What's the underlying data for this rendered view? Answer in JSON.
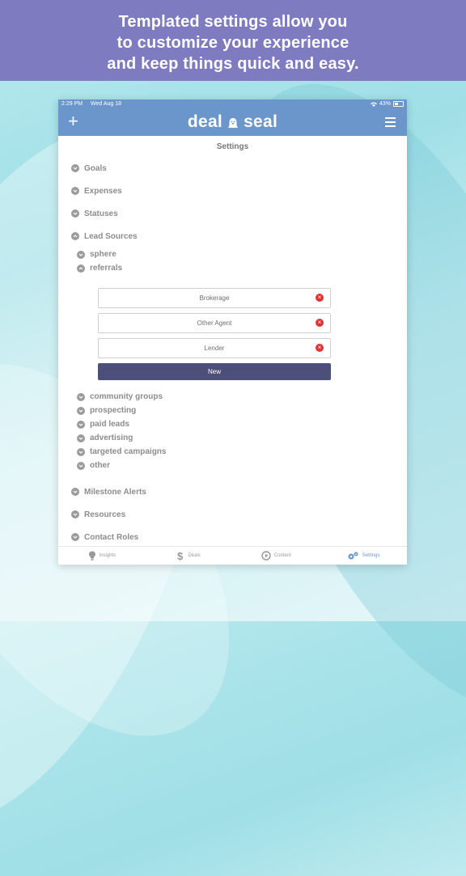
{
  "banner": {
    "line1": "Templated settings allow you",
    "line2": "to customize your experience",
    "line3": "and keep things quick and easy."
  },
  "statusbar": {
    "time": "2:29 PM",
    "date": "Wed Aug 18",
    "battery": "43%"
  },
  "app": {
    "logo_left": "deal",
    "logo_right": "seal",
    "plus": "+"
  },
  "colors": {
    "banner": "#7e7bc1",
    "nav": "#6b96cc",
    "new_button": "#4c4f79",
    "remove": "#e03333"
  },
  "settings": {
    "title": "Settings",
    "sections_top": [
      "Goals",
      "Expenses",
      "Statuses"
    ],
    "lead_sources": {
      "label": "Lead Sources",
      "sub_top": [
        "sphere",
        "referrals"
      ],
      "referrals_items": [
        "Brokerage",
        "Other Agent",
        "Lender"
      ],
      "new_label": "New",
      "sub_rest": [
        "community groups",
        "prospecting",
        "paid leads",
        "advertising",
        "targeted campaigns",
        "other"
      ]
    },
    "sections_bottom": [
      "Milestone Alerts",
      "Resources",
      "Contact Roles"
    ]
  },
  "tabs": [
    {
      "label": "Insights",
      "icon": "lightbulb-icon"
    },
    {
      "label": "Deals",
      "icon": "dollar-icon"
    },
    {
      "label": "Content",
      "icon": "play-icon"
    },
    {
      "label": "Settings",
      "icon": "gears-icon"
    }
  ]
}
